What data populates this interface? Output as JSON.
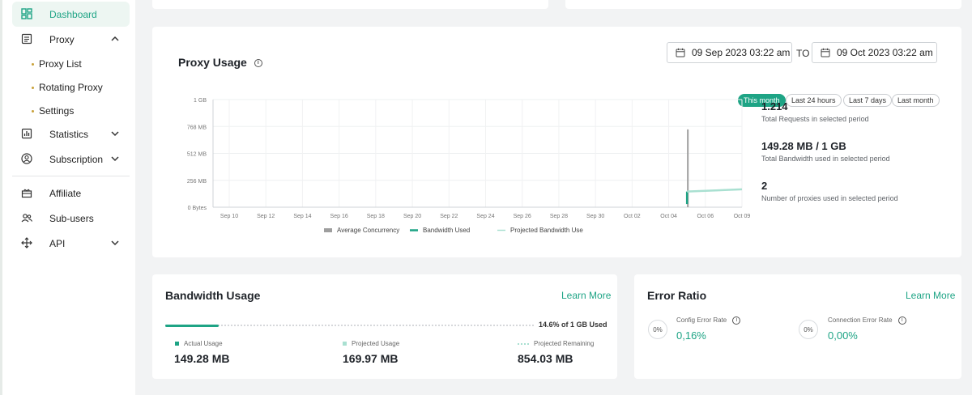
{
  "sidebar": {
    "items": [
      {
        "label": "Dashboard"
      },
      {
        "label": "Proxy"
      },
      {
        "label": "Proxy List"
      },
      {
        "label": "Rotating Proxy"
      },
      {
        "label": "Settings"
      },
      {
        "label": "Statistics"
      },
      {
        "label": "Subscription"
      },
      {
        "label": "Affiliate"
      },
      {
        "label": "Sub-users"
      },
      {
        "label": "API"
      }
    ]
  },
  "proxy_usage": {
    "title": "Proxy Usage",
    "date_from": "09 Sep 2023 03:22 am",
    "to_label": "TO",
    "date_to": "09 Oct 2023 03:22 am",
    "ranges": [
      "This month",
      "Last 24 hours",
      "Last 7 days",
      "Last month"
    ],
    "active_range": "This month",
    "stats": [
      {
        "value": "1.214",
        "label": "Total Requests in selected period"
      },
      {
        "value": "149.28 MB / 1 GB",
        "label": "Total Bandwidth used in selected period"
      },
      {
        "value": "2",
        "label": "Number of proxies used in selected period"
      }
    ]
  },
  "chart_data": {
    "type": "line",
    "x": [
      "Sep 10",
      "Sep 12",
      "Sep 14",
      "Sep 16",
      "Sep 18",
      "Sep 20",
      "Sep 22",
      "Sep 24",
      "Sep 26",
      "Sep 28",
      "Sep 30",
      "Oct 02",
      "Oct 04",
      "Oct 06",
      "Oct 09"
    ],
    "y_ticks": [
      "1 GB",
      "768 MB",
      "512 MB",
      "256 MB",
      "0 Bytes"
    ],
    "ylim_mb": [
      0,
      1024
    ],
    "grid": true,
    "legend_position": "bottom",
    "series": [
      {
        "name": "Average Concurrency",
        "color": "#9e9e9e",
        "points": [
          [
            "Oct 05",
            0
          ],
          [
            "Oct 05",
            740
          ]
        ]
      },
      {
        "name": "Bandwidth Used",
        "color": "#1ea485",
        "points": [
          [
            "Oct 05",
            30
          ],
          [
            "Oct 05",
            149
          ]
        ]
      },
      {
        "name": "Projected Bandwidth Use",
        "color": "#a9e0d1",
        "points": [
          [
            "Oct 05",
            149
          ],
          [
            "Oct 09",
            170
          ]
        ]
      }
    ]
  },
  "bandwidth": {
    "title": "Bandwidth Usage",
    "learn_more": "Learn More",
    "percent_text": "14.6% of 1 GB Used",
    "used_fraction": 0.146,
    "items": [
      {
        "label": "Actual Usage",
        "value": "149.28 MB",
        "color": "#1ea485"
      },
      {
        "label": "Projected Usage",
        "value": "169.97 MB",
        "color": "#a9e0d1"
      },
      {
        "label": "Projected Remaining",
        "value": "854.03 MB",
        "color": "#a9e0d1"
      }
    ]
  },
  "error_ratio": {
    "title": "Error Ratio",
    "learn_more": "Learn More",
    "items": [
      {
        "circle": "0%",
        "label": "Config Error Rate",
        "value": "0,16%"
      },
      {
        "circle": "0%",
        "label": "Connection Error Rate",
        "value": "0,00%"
      }
    ]
  },
  "colors": {
    "accent": "#1ea485",
    "light_accent": "#a9e0d1",
    "page_bg": "#f2f3f4"
  }
}
